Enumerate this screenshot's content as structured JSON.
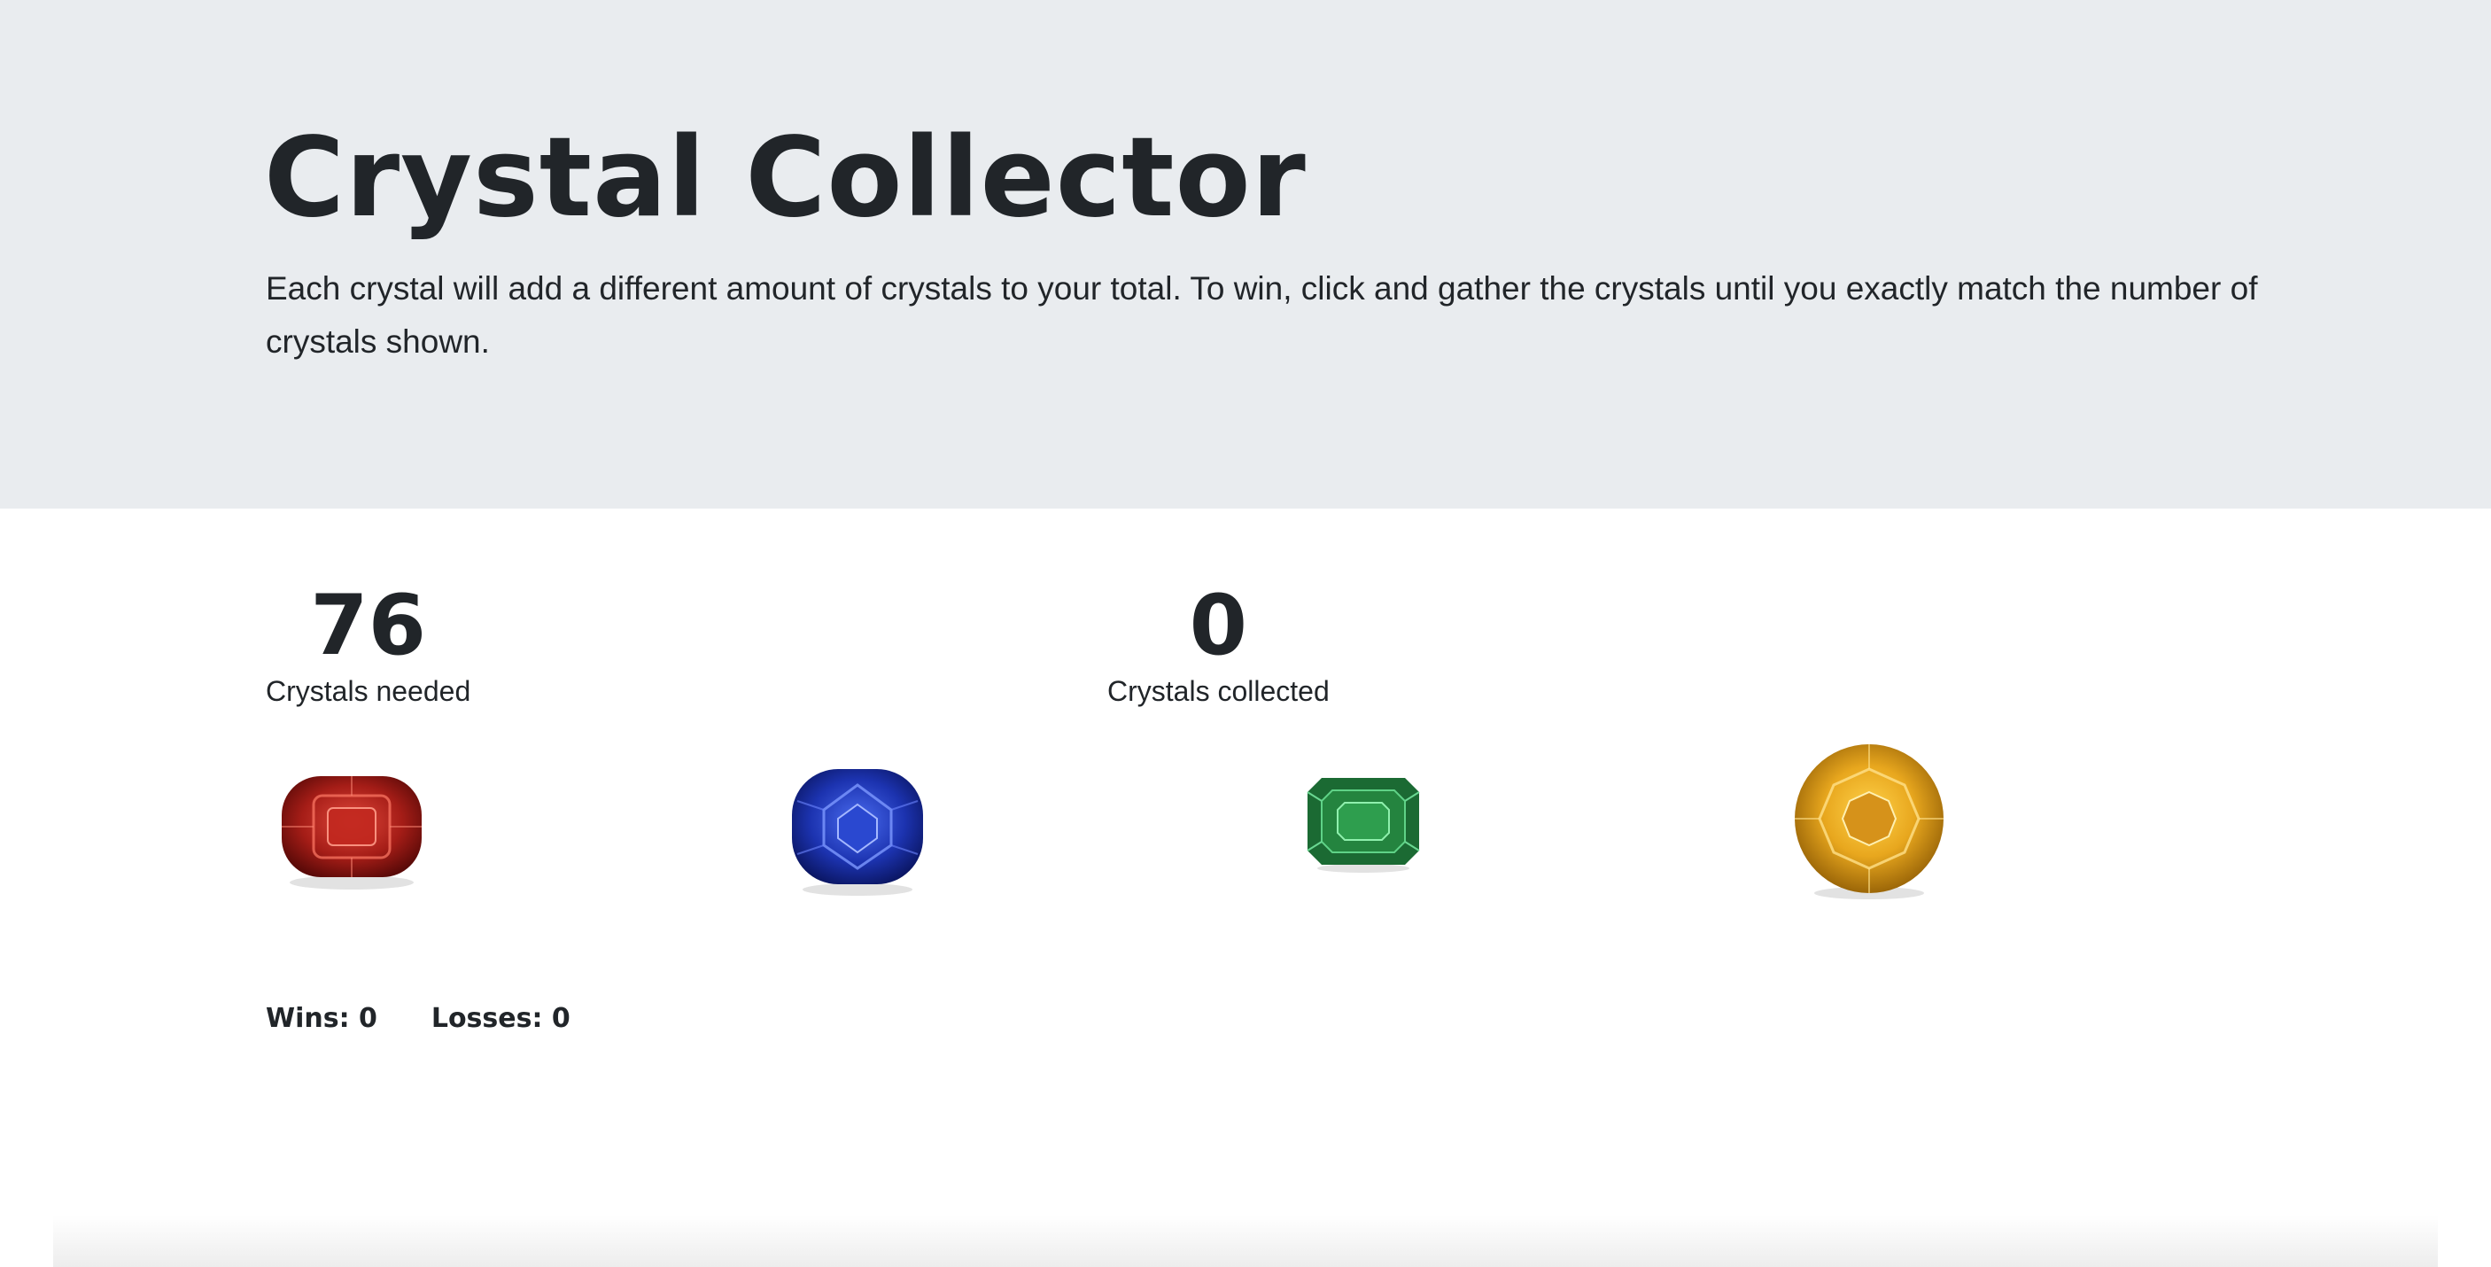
{
  "header": {
    "title": "Crystal Collector",
    "description": "Each crystal will add a different amount of crystals to your total. To win, click and gather the crystals until you exactly match the number of crystals shown."
  },
  "target": {
    "value": "76",
    "label": "Crystals needed"
  },
  "collected": {
    "value": "0",
    "label": "Crystals collected"
  },
  "crystals": [
    {
      "name": "red-crystal",
      "color": "#b3231c"
    },
    {
      "name": "blue-crystal",
      "color": "#1f3fb8"
    },
    {
      "name": "green-crystal",
      "color": "#1f7a3a"
    },
    {
      "name": "yellow-crystal",
      "color": "#e6a91c"
    }
  ],
  "score": {
    "wins_label": "Wins:",
    "wins_value": "0",
    "losses_label": "Losses:",
    "losses_value": "0"
  }
}
